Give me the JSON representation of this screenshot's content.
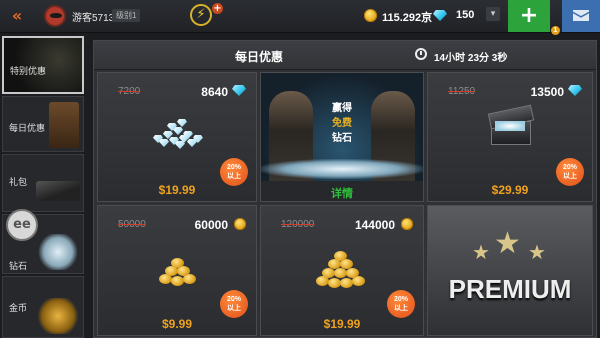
{
  "topbar": {
    "back_icon": "double-chevron-left-icon",
    "player_name": "游客5713",
    "player_level": "级别1",
    "gold": "115.292京",
    "diamonds": "150",
    "add_label": "+",
    "badge": "1"
  },
  "sidebar": {
    "items": [
      {
        "label": "特别优惠"
      },
      {
        "label": "每日优惠"
      },
      {
        "label": "礼包"
      },
      {
        "label": "钻石"
      },
      {
        "label": "金币"
      }
    ]
  },
  "panel": {
    "title": "每日优惠",
    "timer": "14小时 23分 3秒"
  },
  "offers": [
    {
      "old": "7200",
      "amount": "8640",
      "currency": "diamond",
      "badge": [
        "20%",
        "以上"
      ],
      "price": "$19.99"
    },
    {
      "promo": [
        "赢得",
        "免费",
        "钻石"
      ],
      "detail": "详情"
    },
    {
      "old": "11250",
      "amount": "13500",
      "currency": "diamond",
      "badge": [
        "20%",
        "以上"
      ],
      "price": "$29.99"
    },
    {
      "old": "50000",
      "amount": "60000",
      "currency": "coin",
      "badge": [
        "20%",
        "以上"
      ],
      "price": "$9.99"
    },
    {
      "old": "120000",
      "amount": "144000",
      "currency": "coin",
      "badge": [
        "20%",
        "以上"
      ],
      "price": "$19.99"
    },
    {
      "premium": "PREMIUM"
    }
  ],
  "colors": {
    "accent_price": "#f0a21e",
    "detail_green": "#2fbf3a",
    "add_green": "#2da33b",
    "mail_blue": "#3c6fb0"
  }
}
